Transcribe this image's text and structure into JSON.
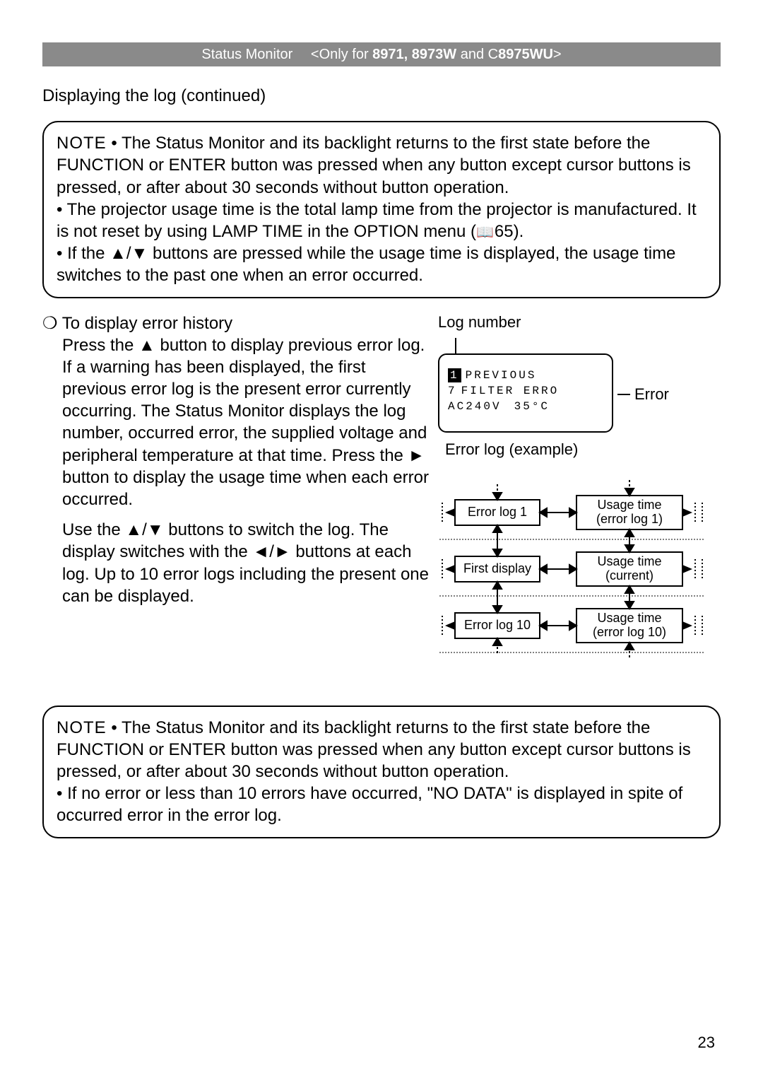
{
  "header": {
    "section": "Status Monitor",
    "only_prefix": "<Only for ",
    "models": "8971, 8973W",
    "and": " and C",
    "model2": "8975WU",
    "suffix": ">"
  },
  "subtitle": "Displaying the log (continued)",
  "note1": {
    "lead": "NOTE",
    "t1": " • The Status Monitor and its backlight returns to the first state before the FUNCTION or ENTER button was pressed when any button except cursor buttons is pressed, or after about 30 seconds without button operation.",
    "t2": "• The projector usage time is the total lamp time from the projector is manufactured. It is not reset by using LAMP TIME in the OPTION menu (",
    "t2_ref": "65",
    "t2_tail": ").",
    "t3a": "• If the ",
    "t3b": " buttons are pressed while the usage time is displayed, the usage time switches to the past one when an error occurred."
  },
  "left": {
    "head": "To display error history",
    "p1a": "Press the ",
    "p1b": " button to display previous error log. If a warning has been displayed, the first previous error log is the present error currently occurring. The Status Monitor displays the log number, occurred error, the supplied voltage and peripheral temperature at that time. Press the ",
    "p1c": " button to display the usage time when each error occurred.",
    "p2a": "Use the ",
    "p2b": " buttons to switch the log. The display switches with the ",
    "p2c": " buttons at each log. Up to 10 error logs including the present one can be displayed."
  },
  "right": {
    "log_number_label": "Log number",
    "display_rows": {
      "r1_idx": "1",
      "r1_txt": "PREVIOUS",
      "r2_idx": "7",
      "r2_txt": "FILTER ERRO",
      "r3_left": "AC240V",
      "r3_right": "35°C"
    },
    "error_label": "Error",
    "caption": "Error log (example)",
    "diagram": {
      "box_a": "Error log 1",
      "box_b": "First display",
      "box_c": "Error log 10",
      "box_d": "Usage time (error log 1)",
      "box_e": "Usage time (current)",
      "box_f": "Usage time (error log 10)"
    }
  },
  "note2": {
    "lead": "NOTE",
    "t1": " • The Status Monitor and its backlight returns to the first state before the FUNCTION or ENTER button was pressed when any button except cursor buttons is pressed, or after about 30 seconds without button operation.",
    "t2": "• If no error or less than 10 errors have occurred, \"NO DATA\" is displayed in spite of occurred error in the error log."
  },
  "page_number": "23"
}
